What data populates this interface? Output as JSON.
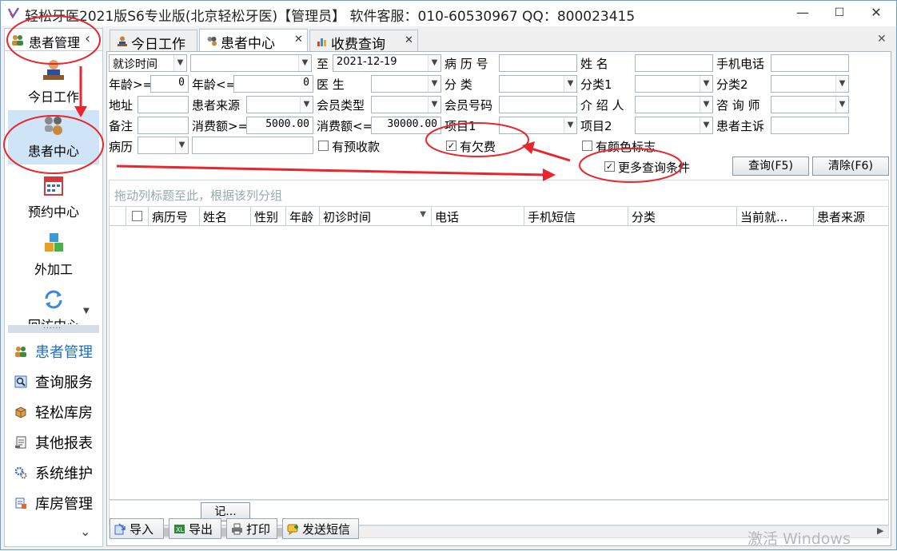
{
  "window": {
    "title": "轻松牙医2021版S6专业版(北京轻松牙医)【管理员】  软件客服：010-60530967 QQ：800023415",
    "minimize": "—",
    "maximize": "☐",
    "close": "✕"
  },
  "sidebar": {
    "header": "患者管理",
    "big_items": [
      {
        "label": "今日工作",
        "icon": "worker-desk-icon"
      },
      {
        "label": "患者中心",
        "icon": "patients-icon"
      },
      {
        "label": "预约中心",
        "icon": "calendar-icon"
      },
      {
        "label": "外加工",
        "icon": "cubes-icon"
      },
      {
        "label": "回访中心",
        "icon": "refresh-icon"
      }
    ],
    "separator": "......",
    "nav_items": [
      {
        "label": "患者管理",
        "icon": "patients-small-icon"
      },
      {
        "label": "查询服务",
        "icon": "search-small-icon"
      },
      {
        "label": "轻松库房",
        "icon": "box-icon"
      },
      {
        "label": "其他报表",
        "icon": "report-icon"
      },
      {
        "label": "系统维护",
        "icon": "gears-icon"
      },
      {
        "label": "库房管理",
        "icon": "warehouse-icon"
      }
    ],
    "more": "⌄"
  },
  "tabs": [
    {
      "label": "今日工作",
      "closable": false
    },
    {
      "label": "患者中心",
      "closable": true
    },
    {
      "label": "收费查询",
      "closable": true
    }
  ],
  "tab_close": "✕",
  "filters": {
    "date_type": "就诊时间",
    "date_from": "",
    "to_label": "至",
    "date_to": "2021-12-19",
    "record_no_label": "病 历 号",
    "name_label": "姓    名",
    "mobile_label": "手机电话",
    "age_min_label": "年龄>=",
    "age_min": "0",
    "age_max_label": "年龄<=",
    "age_max": "0",
    "doctor_label": "医    生",
    "category_label": "分    类",
    "category1_label": "分类1",
    "category2_label": "分类2",
    "address_label": "地址",
    "source_label": "患者来源",
    "member_type_label": "会员类型",
    "member_no_label": "会员号码",
    "referrer_label": "介 绍 人",
    "consultant_label": "咨 询 师",
    "remark_label": "备注",
    "spend_min_label": "消费额>=",
    "spend_min": "5000.00",
    "spend_max_label": "消费额<=",
    "spend_max": "30000.00",
    "item1_label": "项目1",
    "item2_label": "项目2",
    "complaint_label": "患者主诉",
    "history_label": "病历",
    "prepaid_label": "有预收款",
    "prepaid_checked": false,
    "arrears_label": "有欠费",
    "arrears_checked": true,
    "color_mark_label": "有颜色标志",
    "color_mark_checked": false,
    "more_label": "更多查询条件",
    "more_checked": true,
    "search_button": "查询(F5)",
    "clear_button": "清除(F6)"
  },
  "grid": {
    "group_hint": "拖动列标题至此，根据该列分组",
    "columns": [
      "",
      "",
      "病历号",
      "姓名",
      "性别",
      "年龄",
      "初诊时间",
      "电话",
      "手机短信",
      "分类",
      "当前就...",
      "患者来源"
    ],
    "sort_arrow": "▼",
    "rows": [],
    "footer_cell": "记..."
  },
  "toolbar": {
    "import": "导入",
    "export": "导出",
    "print": "打印",
    "sms": "发送短信"
  },
  "watermark": "激活 Windows",
  "accent_color": "#1e6ec8",
  "annotation_color": "#e8262b"
}
